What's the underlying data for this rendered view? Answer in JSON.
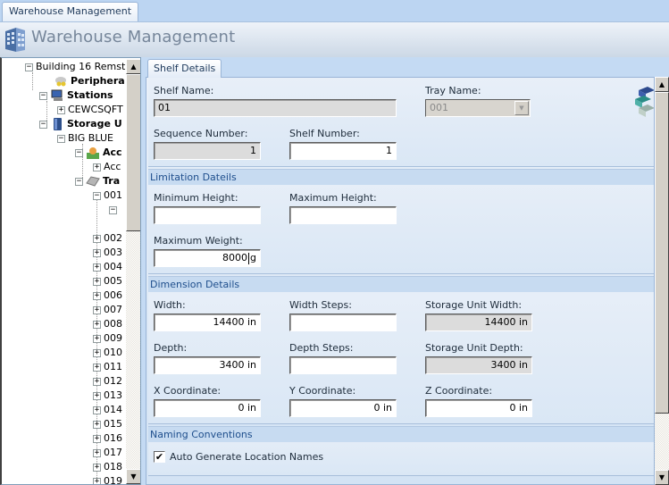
{
  "window": {
    "doc_tab": "Warehouse Management",
    "app_title": "Warehouse Management",
    "app_icon": "building-icon"
  },
  "tree": {
    "items": [
      {
        "label": "Building 16 Remst",
        "toggle": "−",
        "bold": false,
        "icon": null
      },
      {
        "label": "Periphera",
        "toggle": null,
        "bold": true,
        "icon": "peripherals-icon"
      },
      {
        "label": "Stations",
        "toggle": "−",
        "bold": true,
        "icon": "computer-icon"
      },
      {
        "label": "CEWCSQFT",
        "toggle": "+",
        "bold": false,
        "icon": null
      },
      {
        "label": "Storage U",
        "toggle": "−",
        "bold": true,
        "icon": "storage-unit-icon"
      },
      {
        "label": "BIG BLUE",
        "toggle": "−",
        "bold": false,
        "icon": null
      },
      {
        "label": "Acc",
        "toggle": "−",
        "bold": true,
        "icon": "accessory-icon"
      },
      {
        "label": "Acc",
        "toggle": "+",
        "bold": false,
        "icon": null
      },
      {
        "label": "Tra",
        "toggle": "−",
        "bold": true,
        "icon": "tray-icon"
      },
      {
        "label": "001",
        "toggle": "−",
        "bold": false,
        "icon": null
      },
      {
        "label": "",
        "toggle": "−",
        "bold": false,
        "icon": null
      },
      {
        "label": "002",
        "toggle": "+"
      },
      {
        "label": "003",
        "toggle": "+"
      },
      {
        "label": "004",
        "toggle": "+"
      },
      {
        "label": "005",
        "toggle": "+"
      },
      {
        "label": "006",
        "toggle": "+"
      },
      {
        "label": "007",
        "toggle": "+"
      },
      {
        "label": "008",
        "toggle": "+"
      },
      {
        "label": "009",
        "toggle": "+"
      },
      {
        "label": "010",
        "toggle": "+"
      },
      {
        "label": "011",
        "toggle": "+"
      },
      {
        "label": "012",
        "toggle": "+"
      },
      {
        "label": "013",
        "toggle": "+"
      },
      {
        "label": "014",
        "toggle": "+"
      },
      {
        "label": "015",
        "toggle": "+"
      },
      {
        "label": "016",
        "toggle": "+"
      },
      {
        "label": "017",
        "toggle": "+"
      },
      {
        "label": "018",
        "toggle": "+"
      },
      {
        "label": "019",
        "toggle": "+"
      }
    ],
    "scroll_up": "▲",
    "scroll_down": "▼"
  },
  "main": {
    "tab": "Shelf Details",
    "shelf": {
      "shelf_name_label": "Shelf Name:",
      "shelf_name_value": "01",
      "tray_name_label": "Tray Name:",
      "tray_name_value": "001",
      "sequence_label": "Sequence Number:",
      "sequence_value": "1",
      "shelf_number_label": "Shelf Number:",
      "shelf_number_value": "1"
    },
    "limitation": {
      "header": "Limitation Dateils",
      "min_height_label": "Minimum Height:",
      "min_height_value": "",
      "max_height_label": "Maximum Height:",
      "max_height_value": "",
      "max_weight_label": "Maximum Weight:",
      "max_weight_value": "8000",
      "max_weight_unit": "g"
    },
    "dimension": {
      "header": "Dimension Details",
      "width_label": "Width:",
      "width_value": "14400 in",
      "width_steps_label": "Width Steps:",
      "width_steps_value": "",
      "su_width_label": "Storage Unit Width:",
      "su_width_value": "14400 in",
      "depth_label": "Depth:",
      "depth_value": "3400 in",
      "depth_steps_label": "Depth Steps:",
      "depth_steps_value": "",
      "su_depth_label": "Storage Unit Depth:",
      "su_depth_value": "3400 in",
      "x_label": "X Coordinate:",
      "x_value": "0 in",
      "y_label": "Y Coordinate:",
      "y_value": "0 in",
      "z_label": "Z Coordinate:",
      "z_value": "0 in"
    },
    "naming": {
      "header": "Naming Conventions",
      "auto_generate_label": "Auto Generate Location Names",
      "auto_generate_checked": true,
      "check_glyph": "✔"
    },
    "scroll_up": "▲",
    "scroll_down": "▼",
    "combo_arrow": "▼"
  }
}
